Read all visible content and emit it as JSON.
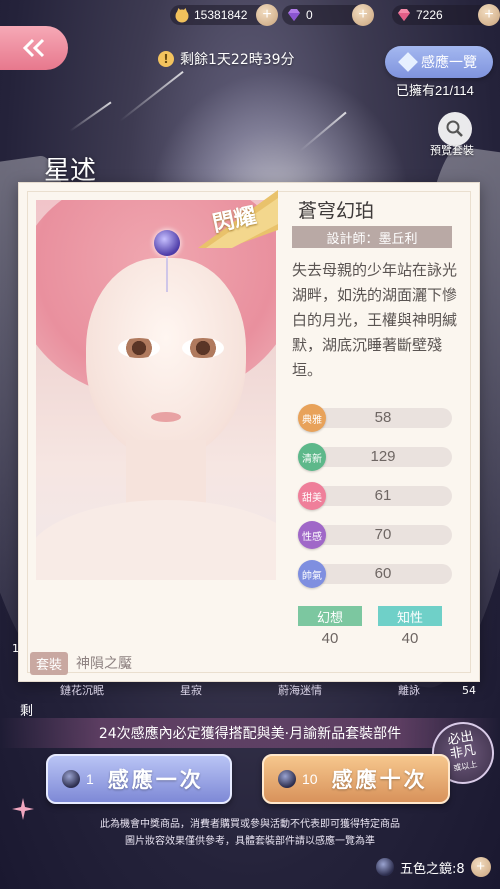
{
  "currencies": {
    "gold": {
      "value": "15381842",
      "icon": "cat-coin-icon"
    },
    "purple_diamond": {
      "value": "0",
      "icon": "purple-diamond-icon"
    },
    "pink_diamond": {
      "value": "7226",
      "icon": "pink-diamond-icon"
    }
  },
  "timer": {
    "text": "剩餘1天22時39分"
  },
  "preview_all": {
    "label": "感應一覽"
  },
  "owned": {
    "text": "已擁有21/114"
  },
  "search": {
    "label": "預覽套裝"
  },
  "background_title": "星述",
  "card": {
    "badge": "閃耀",
    "name": "蒼穹幻珀",
    "designer": "設計師：墨丘利",
    "description": "失去母親的少年站在詠光湖畔，如洗的湖面灑下慘白的月光，王權與神明緘默，湖底沉睡著斷壁殘垣。",
    "stats": [
      {
        "label": "典雅",
        "value": "58",
        "color": "#e8a25a"
      },
      {
        "label": "清新",
        "value": "129",
        "color": "#5db88a"
      },
      {
        "label": "甜美",
        "value": "61",
        "color": "#ef7f9a"
      },
      {
        "label": "性感",
        "value": "70",
        "color": "#a068c8"
      },
      {
        "label": "帥氣",
        "value": "60",
        "color": "#7f8fe0"
      }
    ],
    "tags": [
      {
        "label": "幻想",
        "value": "40",
        "color": "#7cc7a0"
      },
      {
        "label": "知性",
        "value": "40",
        "color": "#6fd0c8"
      }
    ],
    "suit_label": "套裝",
    "suit_value": "神隕之魘"
  },
  "below_row": [
    "鏈花沉眠",
    "星寂",
    "蔚海迷情",
    "離詠"
  ],
  "side_left_top": "1",
  "side_left": "剩",
  "side_right": "54",
  "guarantee": "24次感應內必定獲得搭配與美·月諭新品套裝部件",
  "must_badge": {
    "line1": "必出",
    "line2": "非凡",
    "line3": "或以上"
  },
  "draw_one": {
    "count": "1",
    "label": "感應一次"
  },
  "draw_ten": {
    "count": "10",
    "label": "感應十次"
  },
  "disclaimer": {
    "line1": "此為機會中獎商品，消費者購買或參與活動不代表即可獲得特定商品",
    "line2": "圖片妝容效果僅供參考，具體套裝部件請以感應一覽為準"
  },
  "mirror": {
    "text": "五色之鏡:8"
  }
}
